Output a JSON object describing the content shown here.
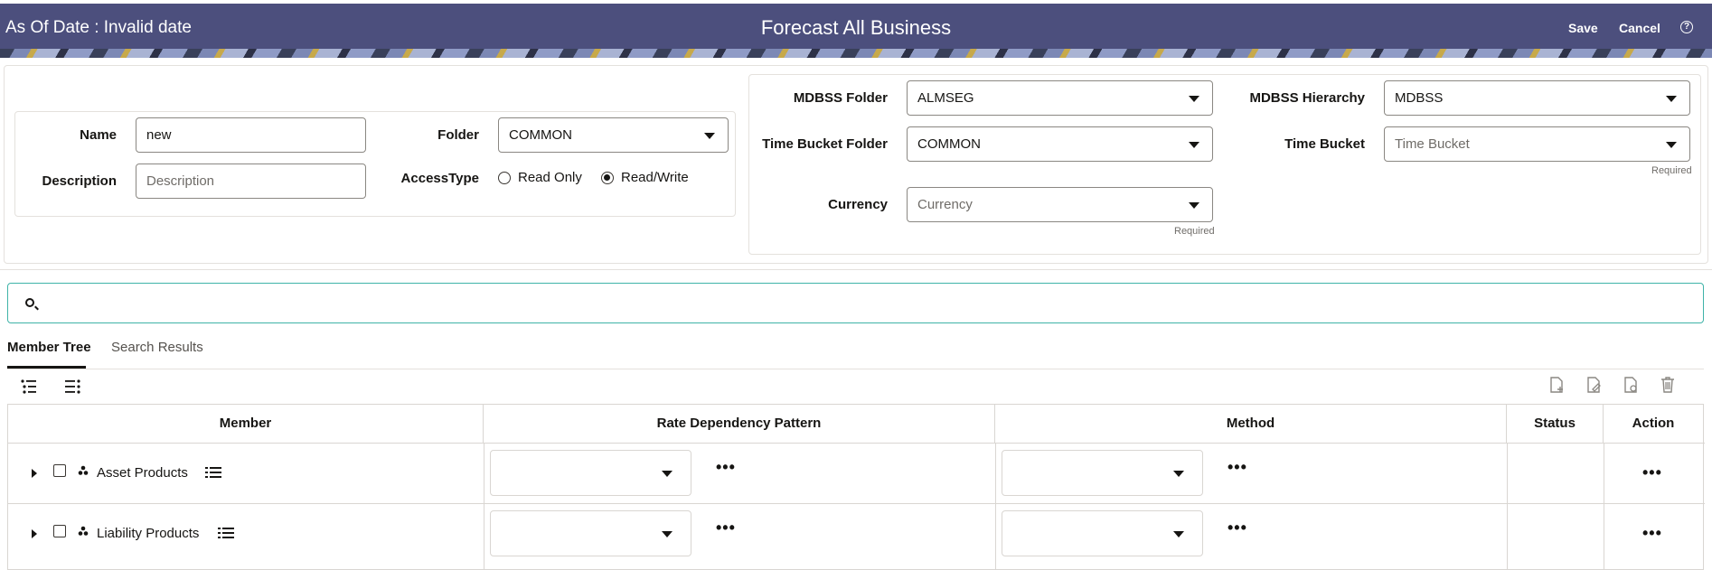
{
  "header": {
    "as_of": "As Of Date : Invalid date",
    "title": "Forecast All Business",
    "save_label": "Save",
    "cancel_label": "Cancel",
    "help_glyph": "?"
  },
  "details": {
    "name_label": "Name",
    "name_value": "new",
    "description_label": "Description",
    "description_placeholder": "Description",
    "folder_label": "Folder",
    "folder_value": "COMMON",
    "access_label": "AccessType",
    "access_options": [
      "Read Only",
      "Read/Write"
    ],
    "access_selected": "Read/Write"
  },
  "settings": {
    "mdbss_folder_label": "MDBSS Folder",
    "mdbss_folder_value": "ALMSEG",
    "mdbss_hierarchy_label": "MDBSS Hierarchy",
    "mdbss_hierarchy_value": "MDBSS",
    "time_bucket_folder_label": "Time Bucket Folder",
    "time_bucket_folder_value": "COMMON",
    "time_bucket_label": "Time Bucket",
    "time_bucket_placeholder": "Time Bucket",
    "time_bucket_required": "Required",
    "currency_label": "Currency",
    "currency_placeholder": "Currency",
    "currency_required": "Required"
  },
  "tabs": [
    {
      "label": "Member Tree",
      "active": true
    },
    {
      "label": "Search Results",
      "active": false
    }
  ],
  "table": {
    "columns": [
      "Member",
      "Rate Dependency Pattern",
      "Method",
      "Status",
      "Action"
    ],
    "rows": [
      {
        "member": "Asset Products",
        "more": "•••"
      },
      {
        "member": "Liability Products",
        "more": "•••"
      }
    ]
  },
  "colors": {
    "header_bg": "#4c4f7d",
    "search_border": "#3fb3a8"
  }
}
